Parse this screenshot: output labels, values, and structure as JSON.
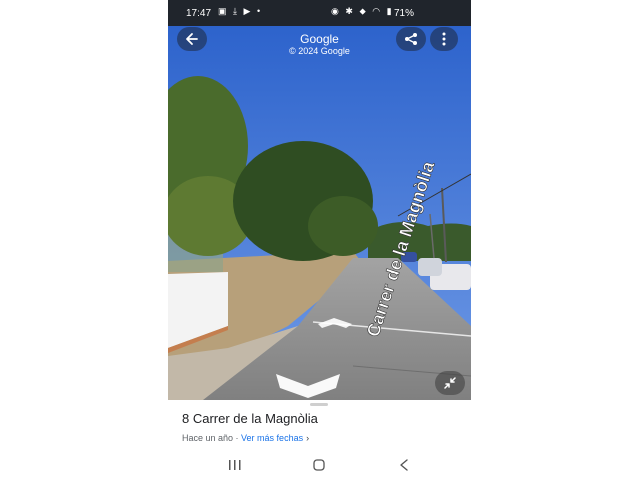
{
  "status_bar": {
    "time": "17:47",
    "battery": "71%",
    "left_icons": [
      "gallery-icon",
      "download-icon",
      "youtube-icon",
      "dot-icon"
    ],
    "right_icons": [
      "alarm-icon",
      "bluetooth-icon",
      "location-icon",
      "wifi-icon",
      "signal-icon"
    ]
  },
  "header": {
    "title": "Google",
    "copyright": "© 2024 Google"
  },
  "street_view": {
    "street_label": "Carrer de la Magnòlia"
  },
  "sheet": {
    "address": "8 Carrer de la Magnòlia",
    "date_text": "Hace un año · ",
    "more_dates_link": "Ver más fechas",
    "chevron": "›"
  },
  "colors": {
    "status_bar": "#20252c",
    "sky": "#3f74d6",
    "road": "#8f8f8f",
    "link": "#1a73e8"
  }
}
